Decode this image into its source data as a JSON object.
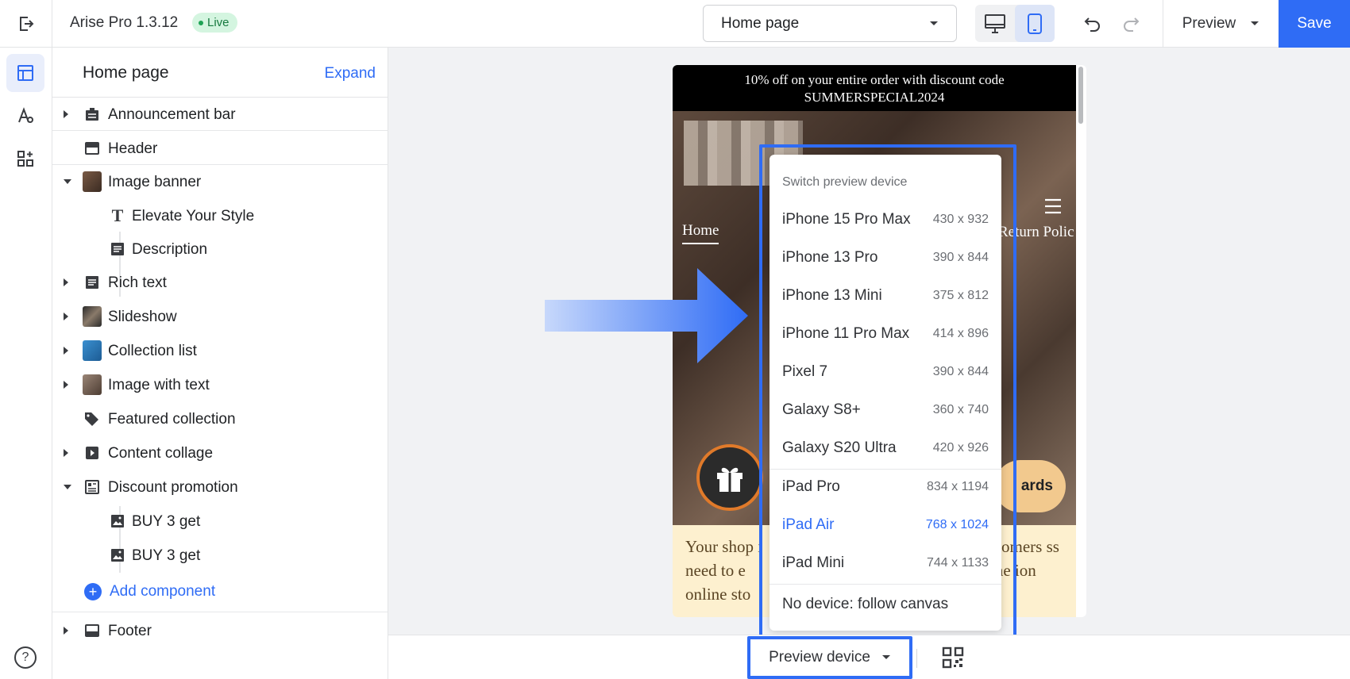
{
  "app": {
    "name": "Arise Pro",
    "version": "1.3.12",
    "status": "Live"
  },
  "toolbar": {
    "page_select": "Home page",
    "preview_label": "Preview",
    "save_label": "Save"
  },
  "sidebar": {
    "title": "Home page",
    "expand_label": "Expand",
    "items": [
      {
        "label": "Announcement bar"
      },
      {
        "label": "Header"
      },
      {
        "label": "Image banner"
      },
      {
        "label": "Elevate Your Style"
      },
      {
        "label": "Description"
      },
      {
        "label": "Rich text"
      },
      {
        "label": "Slideshow"
      },
      {
        "label": "Collection list"
      },
      {
        "label": "Image with text"
      },
      {
        "label": "Featured collection"
      },
      {
        "label": "Content collage"
      },
      {
        "label": "Discount promotion"
      },
      {
        "label": "BUY 3 get"
      },
      {
        "label": "BUY 3 get"
      },
      {
        "label": "Footer"
      }
    ],
    "add_component": "Add component"
  },
  "preview": {
    "announcement": "10% off on your entire order with discount code SUMMERSPECIAL2024",
    "nav_home": "Home",
    "nav_partial": "Return Polic",
    "rewards": "ards",
    "cream_left": "Your shop i need to e online sto",
    "cream_right": "stomers ss the ion"
  },
  "device_menu": {
    "title": "Switch preview device",
    "items": [
      {
        "name": "iPhone 15 Pro Max",
        "size": "430 x 932"
      },
      {
        "name": "iPhone 13 Pro",
        "size": "390 x 844"
      },
      {
        "name": "iPhone 13 Mini",
        "size": "375 x 812"
      },
      {
        "name": "iPhone 11 Pro Max",
        "size": "414 x 896"
      },
      {
        "name": "Pixel 7",
        "size": "390 x 844"
      },
      {
        "name": "Galaxy S8+",
        "size": "360 x 740"
      },
      {
        "name": "Galaxy S20 Ultra",
        "size": "420 x 926"
      },
      {
        "name": "iPad Pro",
        "size": "834 x 1194"
      },
      {
        "name": "iPad Air",
        "size": "768 x 1024",
        "selected": true
      },
      {
        "name": "iPad Mini",
        "size": "744 x 1133"
      }
    ],
    "no_device": "No device: follow canvas"
  },
  "bottom": {
    "preview_device": "Preview device"
  },
  "colors": {
    "accent": "#2f6cf5",
    "live_bg": "#d4f5e0",
    "announce_bg": "#000000",
    "cream": "#fdf0cf"
  }
}
